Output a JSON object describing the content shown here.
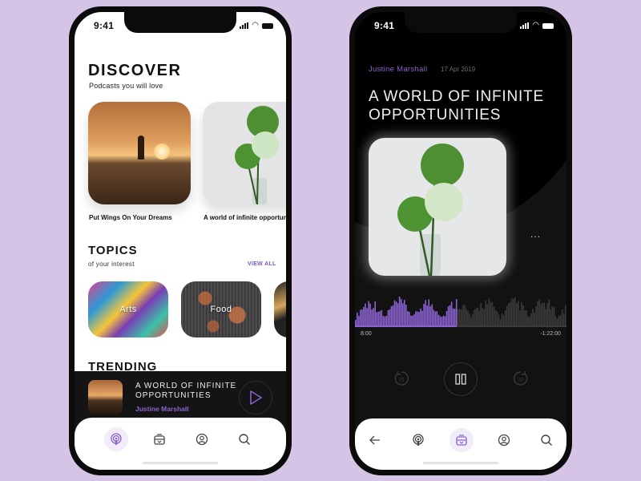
{
  "colors": {
    "background": "#d6c4e6",
    "accent": "#8b62d0",
    "dark_surface": "#121212"
  },
  "left_phone": {
    "status": {
      "time": "9:41"
    },
    "discover": {
      "title": "DISCOVER",
      "subtitle": "Podcasts you will love",
      "cards": [
        {
          "title": "Put Wings On Your Dreams",
          "image": "sunset-walker"
        },
        {
          "title": "A world of infinite opportun",
          "image": "green-flowers"
        }
      ]
    },
    "topics": {
      "title": "TOPICS",
      "subtitle": "of your interest",
      "view_all": "VIEW ALL",
      "items": [
        {
          "label": "Arts"
        },
        {
          "label": "Food"
        },
        {
          "label": ""
        }
      ]
    },
    "trending": {
      "title": "TRENDING"
    },
    "mini_player": {
      "title": "A WORLD OF INFINITE OPPORTUNITIES",
      "author": "Justine Marshall",
      "button_icon": "play-icon"
    },
    "tabbar": {
      "items": [
        {
          "icon": "podcast-icon",
          "active": true
        },
        {
          "icon": "library-icon",
          "active": false
        },
        {
          "icon": "profile-icon",
          "active": false
        },
        {
          "icon": "search-icon",
          "active": false
        }
      ]
    }
  },
  "right_phone": {
    "status": {
      "time": "9:41"
    },
    "episode": {
      "author": "Justine Marshall",
      "date": "17 Apr 2019",
      "title": "A WORLD OF INFINITE OPPORTUNITIES",
      "more_label": "..."
    },
    "player": {
      "elapsed": "8:00",
      "remaining": "-1:22:00",
      "progress": 0.48,
      "rewind_seconds": "15",
      "forward_seconds": "30"
    },
    "tabbar": {
      "items": [
        {
          "icon": "back-arrow-icon",
          "active": false
        },
        {
          "icon": "podcast-icon",
          "active": false
        },
        {
          "icon": "library-icon",
          "active": true
        },
        {
          "icon": "profile-icon",
          "active": false
        },
        {
          "icon": "search-icon",
          "active": false
        }
      ]
    }
  }
}
